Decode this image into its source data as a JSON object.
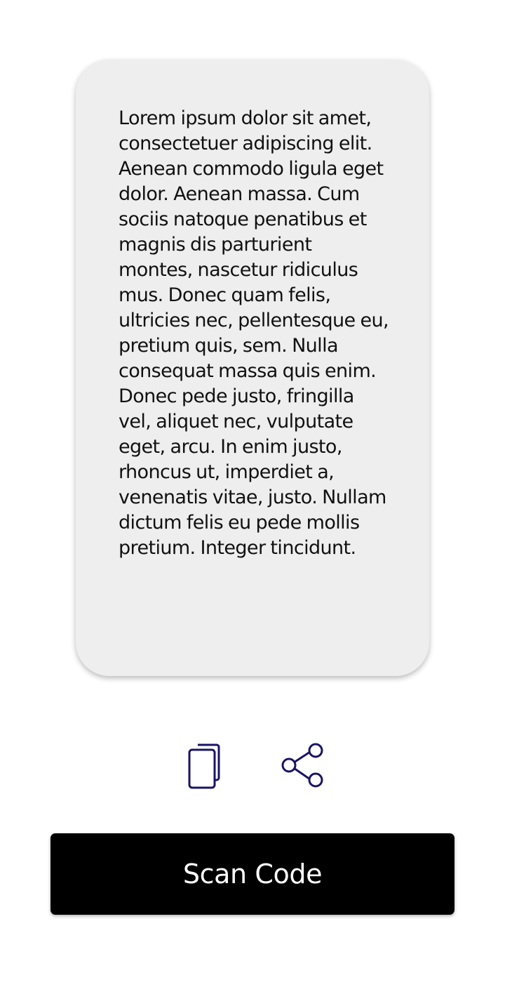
{
  "result": {
    "text": "Lorem ipsum dolor sit amet, consectetuer adipiscing elit. Aenean commodo ligula eget dolor. Aenean massa. Cum sociis natoque penatibus et magnis dis parturient montes, nascetur ridiculus mus. Donec quam felis, ultricies nec, pellentesque eu, pretium quis, sem. Nulla consequat massa quis enim. Donec pede justo, fringilla vel, aliquet nec, vulputate eget, arcu. In enim justo, rhoncus ut, imperdiet a, venenatis vitae, justo. Nullam dictum felis eu pede mollis pretium. Integer tincidunt."
  },
  "actions": {
    "copy_icon": "copy-icon",
    "share_icon": "share-icon",
    "icon_color": "#1a1463"
  },
  "scan_button": {
    "label": "Scan Code"
  }
}
